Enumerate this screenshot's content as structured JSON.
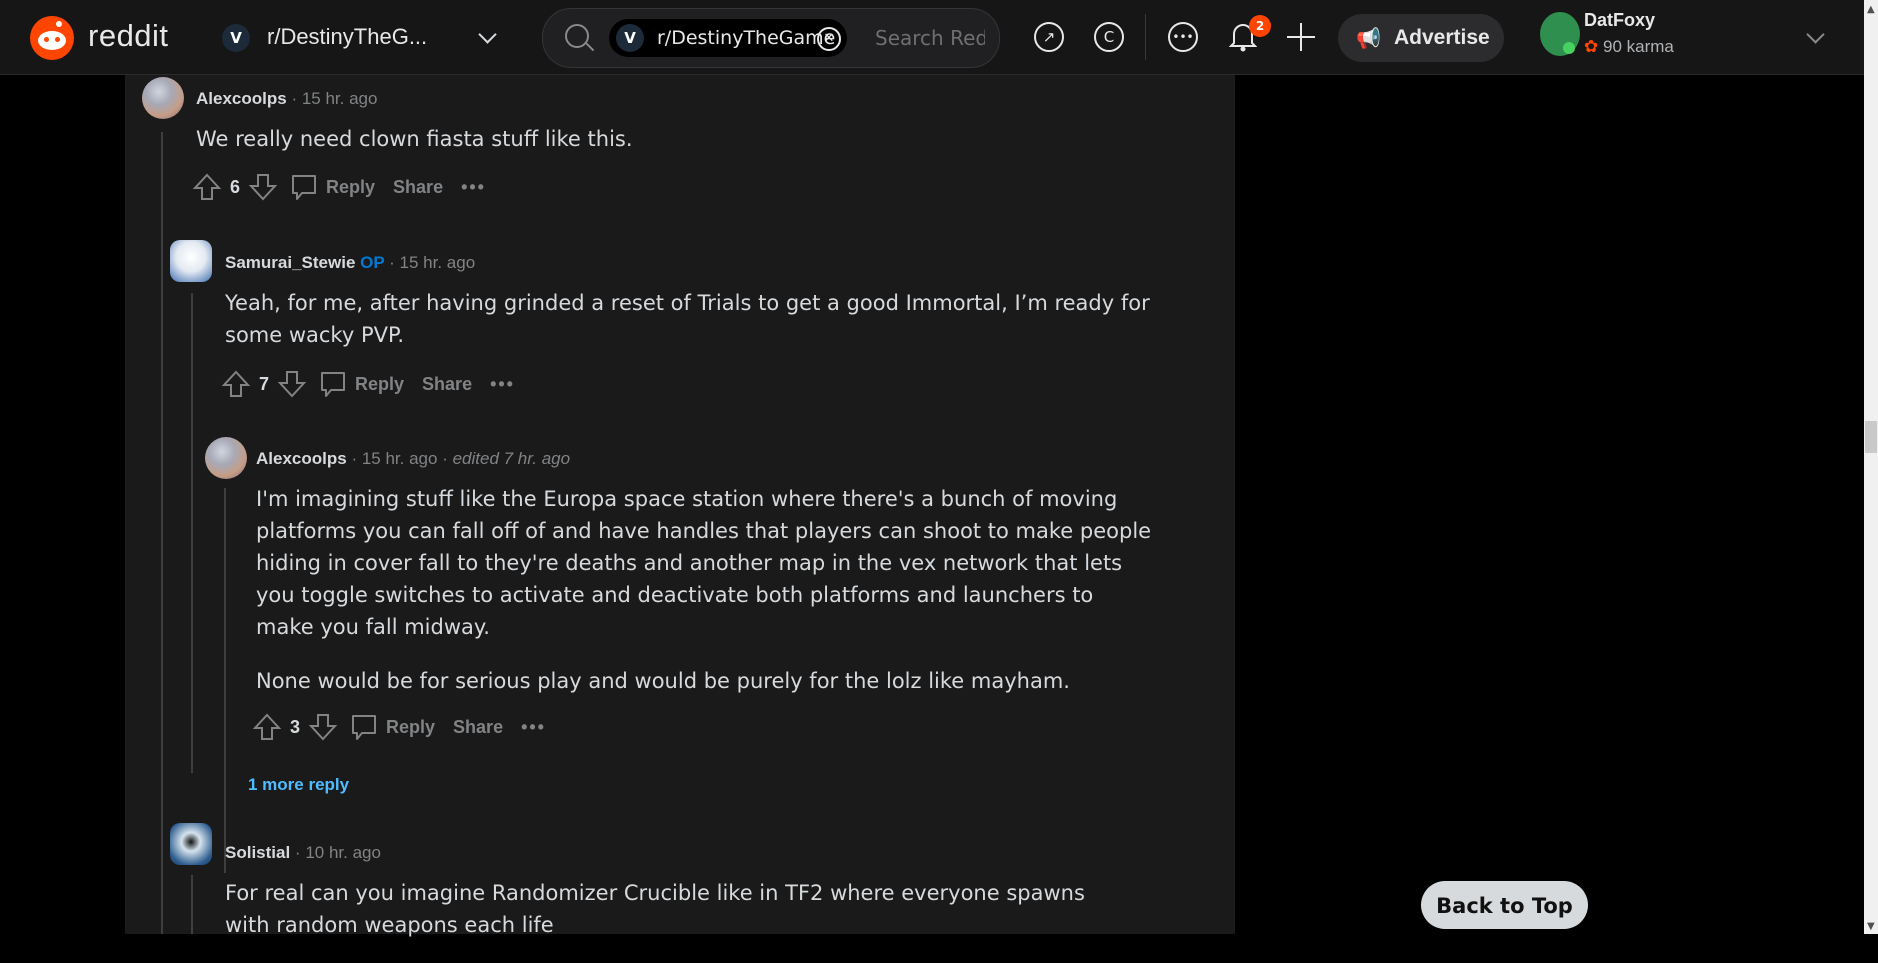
{
  "header": {
    "brand": "reddit",
    "subreddit": "r/DestinyTheG...",
    "search": {
      "chip_label": "r/DestinyTheGame",
      "placeholder": "Search Reddit"
    },
    "icons": [
      "popular-icon",
      "coins-icon",
      "chat-icon",
      "notifications-icon",
      "create-icon"
    ],
    "notification_count": "2",
    "advertise_label": "Advertise",
    "user": {
      "name": "DatFoxy",
      "karma": "90 karma"
    }
  },
  "comments": [
    {
      "author": "Alexcoolps",
      "op": "",
      "time": "15 hr. ago",
      "edited": "",
      "body": [
        "We really need clown fiasta stuff like this."
      ],
      "votes": "6",
      "reply_label": "Reply",
      "share_label": "Share"
    },
    {
      "author": "Samurai_Stewie",
      "op": "OP",
      "time": "15 hr. ago",
      "edited": "",
      "body": [
        "Yeah, for me, after having grinded a reset of Trials to get a good Immortal, I’m ready for some wacky PVP."
      ],
      "votes": "7",
      "reply_label": "Reply",
      "share_label": "Share"
    },
    {
      "author": "Alexcoolps",
      "op": "",
      "time": "15 hr. ago",
      "edited": "edited 7 hr. ago",
      "body": [
        "I'm imagining stuff like the Europa space station where there's a bunch of moving platforms you can fall off of and have handles that players can shoot to make people hiding in cover fall to they're deaths and another map in the vex network that lets you toggle switches to activate and deactivate both platforms and launchers to make you fall midway.",
        "None would be for serious play and would be purely for the lolz like mayham."
      ],
      "votes": "3",
      "reply_label": "Reply",
      "share_label": "Share",
      "more_replies": "1 more reply"
    },
    {
      "author": "Solistial",
      "op": "",
      "time": "10 hr. ago",
      "edited": "",
      "body": [
        "For real can you imagine Randomizer Crucible like in TF2 where everyone spawns with random weapons each life"
      ]
    }
  ],
  "back_to_top_label": "Back to Top",
  "colors": {
    "brand": "#ff4500",
    "op": "#0079d3",
    "link": "#4fbcff",
    "online": "#46d160"
  }
}
